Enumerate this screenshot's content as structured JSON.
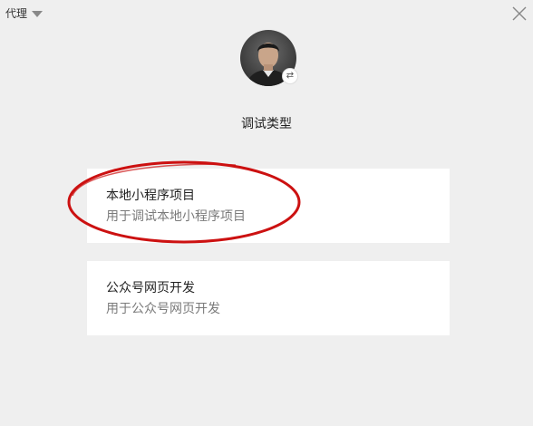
{
  "header": {
    "proxy_label": "代理",
    "proxy_icon": "chevron-down-icon",
    "close_icon": "close-icon"
  },
  "user": {
    "avatar_icon": "avatar",
    "switch_icon": "switch-account-icon",
    "switch_glyph": "⇄"
  },
  "title": "调试类型",
  "options": [
    {
      "title": "本地小程序项目",
      "desc": "用于调试本地小程序项目"
    },
    {
      "title": "公众号网页开发",
      "desc": "用于公众号网页开发"
    }
  ],
  "annotation": {
    "color": "#cc1111",
    "target": "options.0"
  }
}
